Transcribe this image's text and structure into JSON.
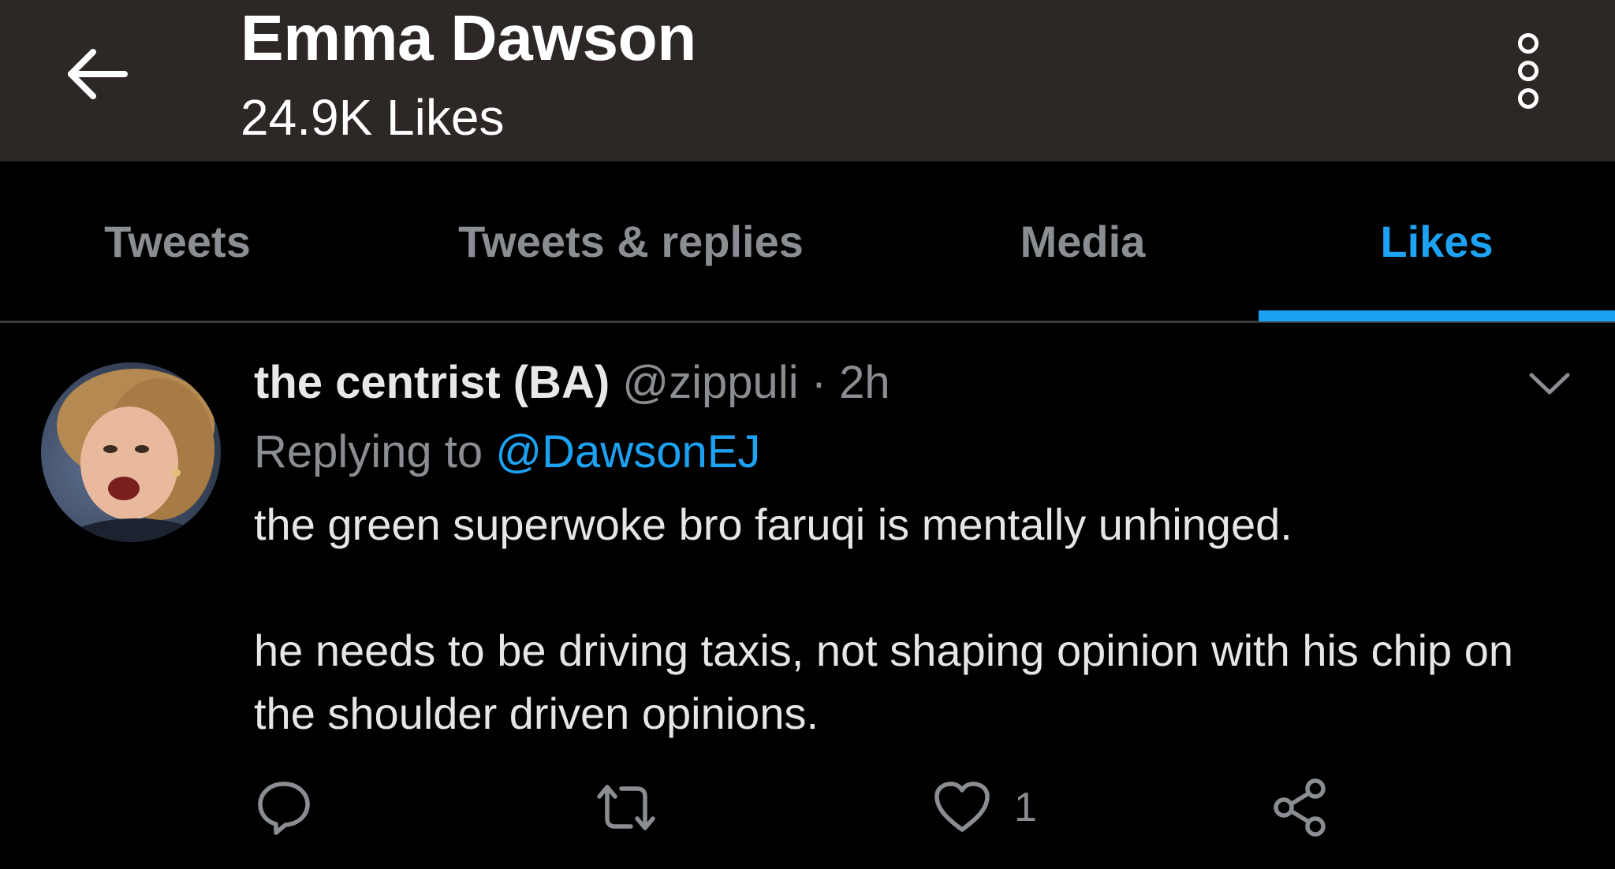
{
  "header": {
    "back_icon": "arrow-left-icon",
    "title": "Emma Dawson",
    "subtitle": "24.9K Likes",
    "overflow_icon": "more-vertical-icon"
  },
  "tabs": [
    {
      "label": "Tweets",
      "active": false
    },
    {
      "label": "Tweets & replies",
      "active": false
    },
    {
      "label": "Media",
      "active": false
    },
    {
      "label": "Likes",
      "active": true
    }
  ],
  "tweet": {
    "author_name": "the centrist (BA)",
    "handle": "@zippuli",
    "separator": "·",
    "time": "2h",
    "replying_prefix": "Replying to",
    "replying_to": "@DawsonEJ",
    "body_line1": "the green superwoke bro faruqi is mentally unhinged.",
    "body_line2": "he needs to be driving taxis, not shaping opinion with his chip on the shoulder driven opinions.",
    "like_count": "1"
  },
  "colors": {
    "header_bg": "#2d2726",
    "background": "#000000",
    "accent": "#1da1f2",
    "muted_text": "#8a8d91"
  }
}
